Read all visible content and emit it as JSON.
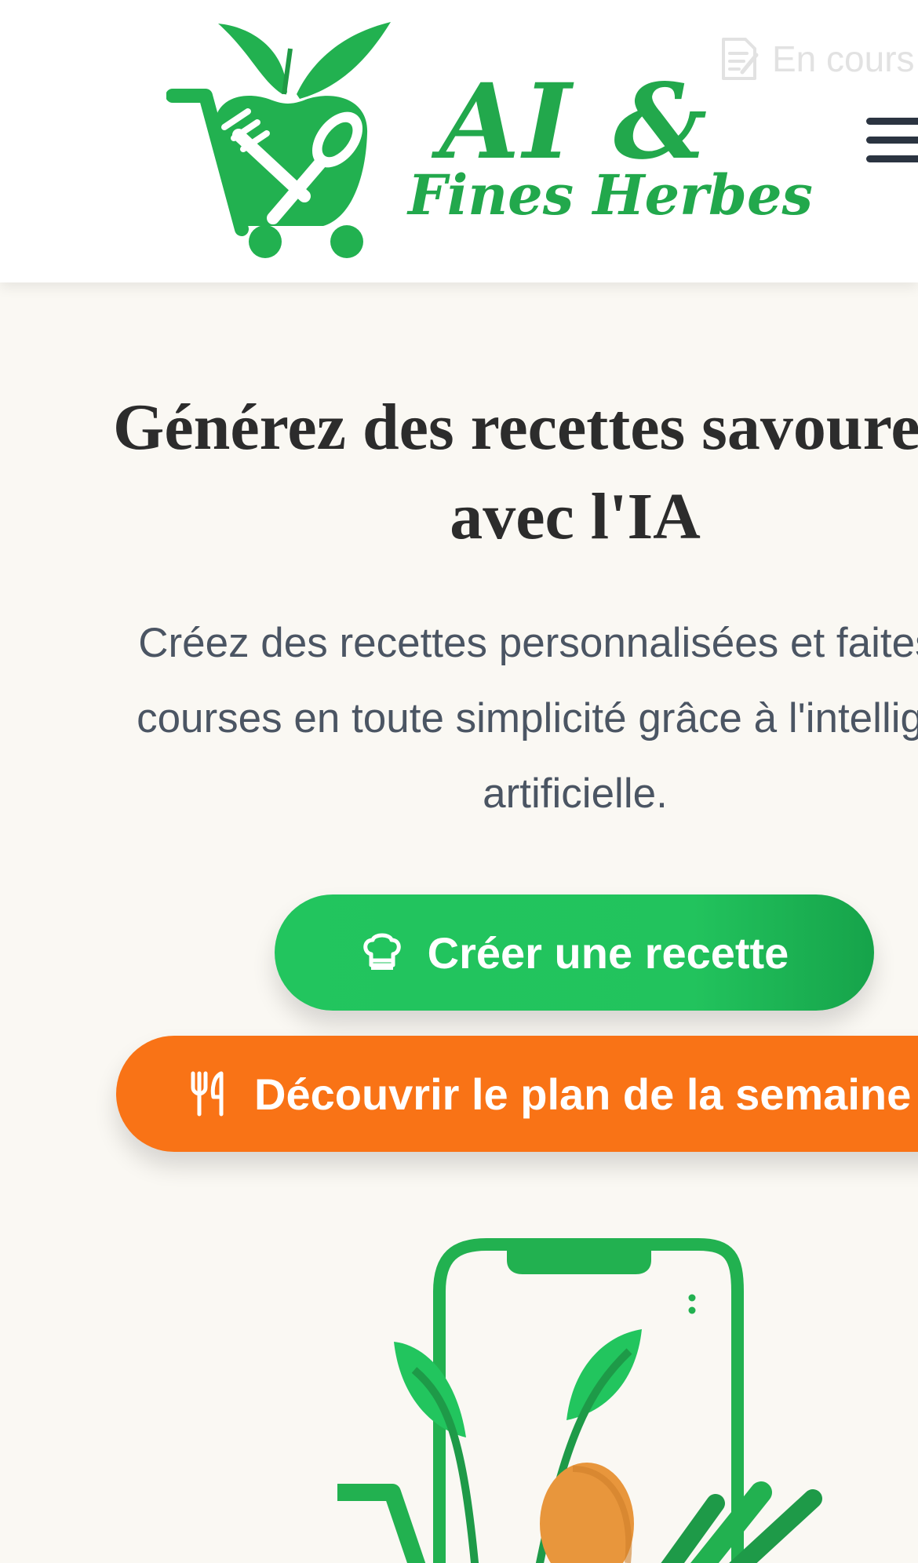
{
  "header": {
    "logo": {
      "line1": "AI &",
      "line2": "Fines Herbes"
    },
    "status_text": "En cours",
    "icons": {
      "status": "document-edit-icon",
      "menu": "hamburger-menu-icon"
    }
  },
  "hero": {
    "title_line1": "Générez des recettes savoureuses",
    "title_line2": "avec l'IA",
    "subtitle_line1": "Créez des recettes personnalisées et faites vos",
    "subtitle_line2": "courses en toute simplicité grâce à l'intelligence",
    "subtitle_line3": "artificielle.",
    "primary_button": {
      "label": "Créer une recette",
      "icon": "chef-hat-icon"
    },
    "secondary_button": {
      "label": "Découvrir le plan de la semaine",
      "icon": "fork-knife-icon"
    }
  },
  "colors": {
    "brand_green": "#22c55e",
    "brand_green_dark": "#16a34a",
    "accent_orange": "#f97316",
    "heading": "#2c2c2c",
    "body_text": "#4b5563",
    "background": "#faf8f3"
  }
}
